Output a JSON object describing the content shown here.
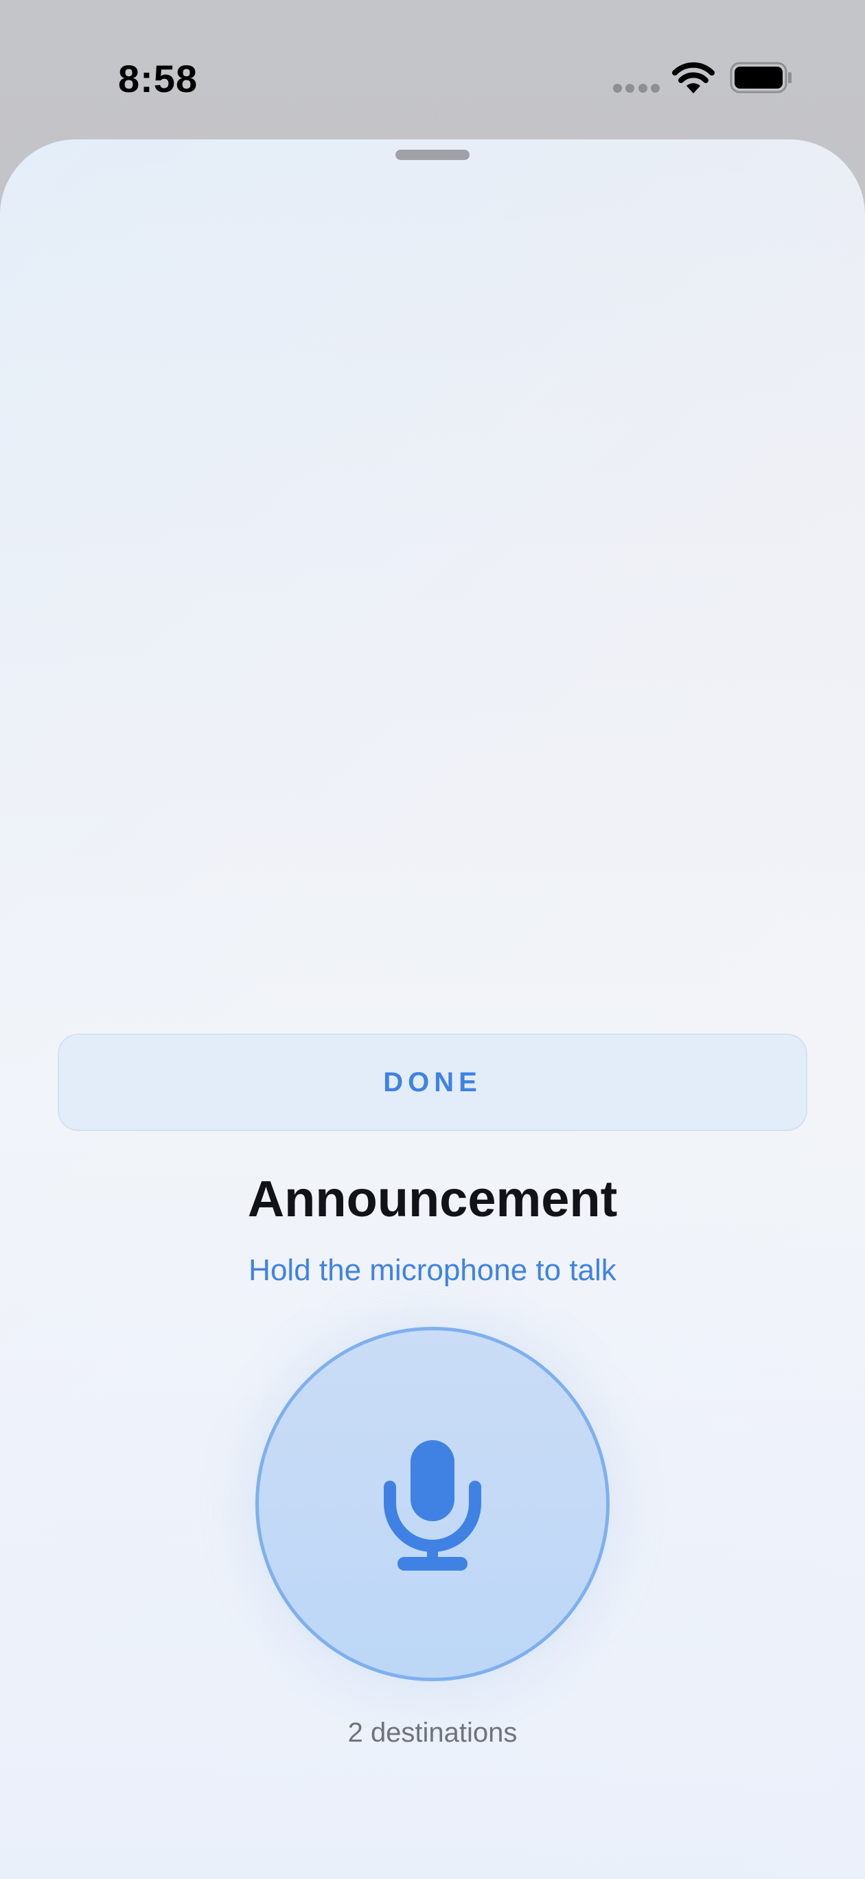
{
  "status_bar": {
    "time": "8:58",
    "wifi_icon": "wifi-icon",
    "battery_icon": "battery-full-icon"
  },
  "sheet": {
    "done_label": "DONE",
    "title": "Announcement",
    "subtitle": "Hold the microphone to talk",
    "mic_icon": "microphone-icon",
    "destinations": "2 destinations"
  },
  "colors": {
    "accent": "#3f82e4",
    "title": "#111318",
    "secondary_text": "#6f737b",
    "mic_fill": "#bdd7f7",
    "mic_ring": "#7eb0ef"
  }
}
